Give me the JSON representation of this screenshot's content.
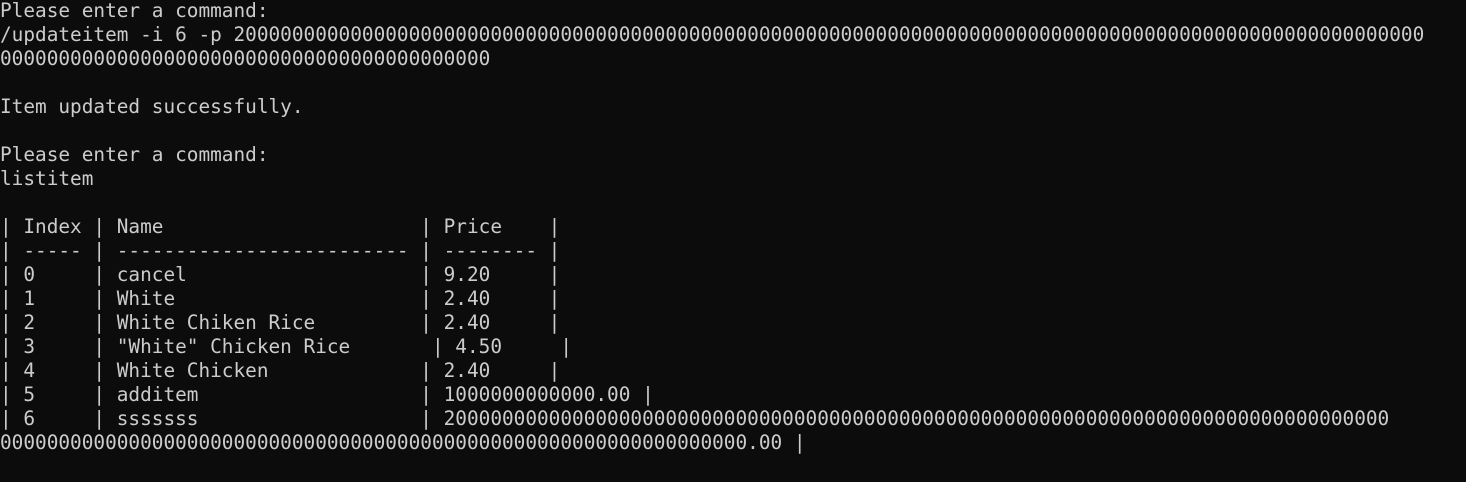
{
  "terminal": {
    "lines": [
      "Please enter a command:",
      "/updateitem -i 6 -p 200000000000000000000000000000000000000000000000000000000000000000000000000000000000000000000000000000",
      "000000000000000000000000000000000000000000",
      "",
      "Item updated successfully.",
      "",
      "Please enter a command:",
      "listitem",
      "",
      "| Index | Name                      | Price    |",
      "| ----- | ------------------------- | -------- |",
      "| 0     | cancel                    | 9.20     |",
      "| 1     | White                     | 2.40     |",
      "| 2     | White Chiken Rice         | 2.40     |",
      "| 3     | \"White\" Chicken Rice       | 4.50     |",
      "| 4     | White Chicken             | 2.40     |",
      "| 5     | additem                   | 1000000000000.00 |",
      "| 6     | sssssss                   | 200000000000000000000000000000000000000000000000000000000000000000000000000000000",
      "0000000000000000000000000000000000000000000000000000000000000000.00 |"
    ]
  }
}
